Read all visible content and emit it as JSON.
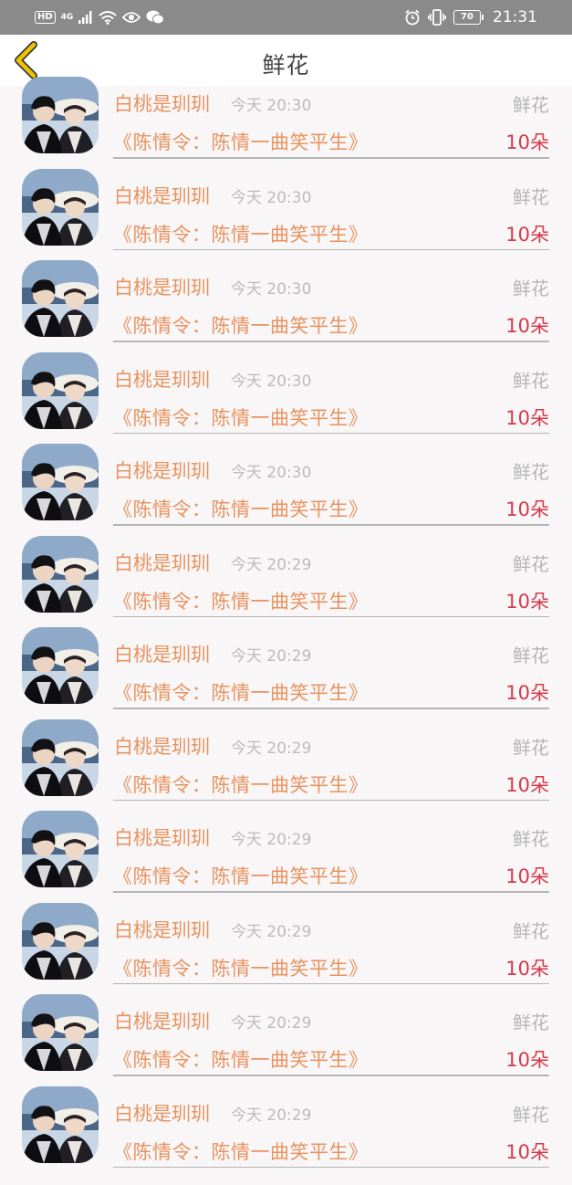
{
  "status_bar": {
    "hd": "HD",
    "network": "4G",
    "battery": "70",
    "time": "21:31",
    "icons": [
      "signal-icon",
      "wifi-icon",
      "eye-icon",
      "wechat-icon",
      "alarm-icon",
      "vibrate-icon",
      "battery-icon"
    ]
  },
  "header": {
    "title": "鲜花",
    "back_icon": "chevron-left-icon",
    "accent": "#f2c100"
  },
  "colors": {
    "name": "#e8935f",
    "count": "#d43a4b",
    "muted": "#b5b5b5"
  },
  "records": [
    {
      "name": "白桃是玔玔",
      "time": "今天 20:30",
      "type": "鲜花",
      "work": "《陈情令：陈情一曲笑平生》",
      "count": "10朵"
    },
    {
      "name": "白桃是玔玔",
      "time": "今天 20:30",
      "type": "鲜花",
      "work": "《陈情令：陈情一曲笑平生》",
      "count": "10朵"
    },
    {
      "name": "白桃是玔玔",
      "time": "今天 20:30",
      "type": "鲜花",
      "work": "《陈情令：陈情一曲笑平生》",
      "count": "10朵"
    },
    {
      "name": "白桃是玔玔",
      "time": "今天 20:30",
      "type": "鲜花",
      "work": "《陈情令：陈情一曲笑平生》",
      "count": "10朵"
    },
    {
      "name": "白桃是玔玔",
      "time": "今天 20:30",
      "type": "鲜花",
      "work": "《陈情令：陈情一曲笑平生》",
      "count": "10朵"
    },
    {
      "name": "白桃是玔玔",
      "time": "今天 20:29",
      "type": "鲜花",
      "work": "《陈情令：陈情一曲笑平生》",
      "count": "10朵"
    },
    {
      "name": "白桃是玔玔",
      "time": "今天 20:29",
      "type": "鲜花",
      "work": "《陈情令：陈情一曲笑平生》",
      "count": "10朵"
    },
    {
      "name": "白桃是玔玔",
      "time": "今天 20:29",
      "type": "鲜花",
      "work": "《陈情令：陈情一曲笑平生》",
      "count": "10朵"
    },
    {
      "name": "白桃是玔玔",
      "time": "今天 20:29",
      "type": "鲜花",
      "work": "《陈情令：陈情一曲笑平生》",
      "count": "10朵"
    },
    {
      "name": "白桃是玔玔",
      "time": "今天 20:29",
      "type": "鲜花",
      "work": "《陈情令：陈情一曲笑平生》",
      "count": "10朵"
    },
    {
      "name": "白桃是玔玔",
      "time": "今天 20:29",
      "type": "鲜花",
      "work": "《陈情令：陈情一曲笑平生》",
      "count": "10朵"
    },
    {
      "name": "白桃是玔玔",
      "time": "今天 20:29",
      "type": "鲜花",
      "work": "《陈情令：陈情一曲笑平生》",
      "count": "10朵"
    }
  ]
}
